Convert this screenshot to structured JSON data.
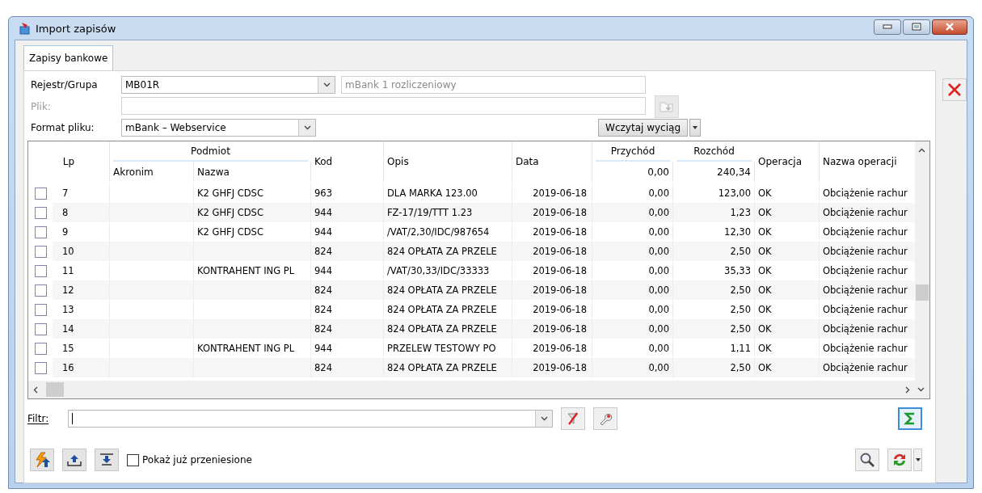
{
  "window": {
    "title": "Import zapisów"
  },
  "tabs": [
    {
      "label": "Zapisy bankowe",
      "selected": true
    }
  ],
  "form": {
    "rejestr_label": "Rejestr/Grupa",
    "rejestr_value": "MB01R",
    "rejestr_name": "mBank 1 rozliczeniowy",
    "plik_label": "Plik:",
    "plik_disabled": true,
    "format_label": "Format pliku:",
    "format_value": "mBank – Webservice",
    "load_button": "Wczytaj wyciąg"
  },
  "table": {
    "header": {
      "lp": "Lp",
      "podmiot": "Podmiot",
      "akronim": "Akronim",
      "nazwa": "Nazwa",
      "kod": "Kod",
      "opis": "Opis",
      "data": "Data",
      "przychod": "Przychód",
      "przychod_total": "0,00",
      "rozchod": "Rozchód",
      "rozchod_total": "240,34",
      "operacja": "Operacja",
      "nazwa_operacji": "Nazwa operacji"
    },
    "rows": [
      {
        "checked": false,
        "lp": "7",
        "nazwa": "K2 GHFJ CDSC",
        "kod": "963",
        "opis": "DLA MARKA 123.00",
        "data": "2019-06-18",
        "przychod": "0,00",
        "rozchod": "123,00",
        "operacja": "OK",
        "nazwa_operacji": "Obciążenie rachur"
      },
      {
        "checked": false,
        "lp": "8",
        "nazwa": "K2 GHFJ CDSC",
        "kod": "944",
        "opis": "FZ-17/19/TTT 1.23",
        "data": "2019-06-18",
        "przychod": "0,00",
        "rozchod": "1,23",
        "operacja": "OK",
        "nazwa_operacji": "Obciążenie rachur"
      },
      {
        "checked": false,
        "lp": "9",
        "nazwa": "K2 GHFJ CDSC",
        "kod": "944",
        "opis": "/VAT/2,30/IDC/987654",
        "data": "2019-06-18",
        "przychod": "0,00",
        "rozchod": "12,30",
        "operacja": "OK",
        "nazwa_operacji": "Obciążenie rachur"
      },
      {
        "checked": false,
        "lp": "10",
        "kod": "824",
        "opis": "824 OPŁATA ZA PRZELE",
        "data": "2019-06-18",
        "przychod": "0,00",
        "rozchod": "2,50",
        "operacja": "OK",
        "nazwa_operacji": "Obciążenie rachur"
      },
      {
        "checked": false,
        "lp": "11",
        "nazwa": "KONTRAHENT ING PL",
        "kod": "944",
        "opis": "/VAT/30,33/IDC/33333",
        "data": "2019-06-18",
        "przychod": "0,00",
        "rozchod": "35,33",
        "operacja": "OK",
        "nazwa_operacji": "Obciążenie rachur"
      },
      {
        "checked": false,
        "lp": "12",
        "kod": "824",
        "opis": "824 OPŁATA ZA PRZELE",
        "data": "2019-06-18",
        "przychod": "0,00",
        "rozchod": "2,50",
        "operacja": "OK",
        "nazwa_operacji": "Obciążenie rachur"
      },
      {
        "checked": false,
        "lp": "13",
        "kod": "824",
        "opis": "824 OPŁATA ZA PRZELE",
        "data": "2019-06-18",
        "przychod": "0,00",
        "rozchod": "2,50",
        "operacja": "OK",
        "nazwa_operacji": "Obciążenie rachur"
      },
      {
        "checked": false,
        "lp": "14",
        "kod": "824",
        "opis": "824 OPŁATA ZA PRZELE",
        "data": "2019-06-18",
        "przychod": "0,00",
        "rozchod": "2,50",
        "operacja": "OK",
        "nazwa_operacji": "Obciążenie rachur"
      },
      {
        "checked": false,
        "lp": "15",
        "nazwa": "KONTRAHENT ING PL",
        "kod": "944",
        "opis": "PRZELEW TESTOWY PO",
        "data": "2019-06-18",
        "przychod": "0,00",
        "rozchod": "1,11",
        "operacja": "OK",
        "nazwa_operacji": "Obciążenie rachur"
      },
      {
        "checked": false,
        "lp": "16",
        "kod": "824",
        "opis": "824 OPŁATA ZA PRZELE",
        "data": "2019-06-18",
        "przychod": "0,00",
        "rozchod": "2,50",
        "operacja": "OK",
        "nazwa_operacji": "Obciążenie rachur"
      }
    ]
  },
  "filter": {
    "label": "Filtr:"
  },
  "show_transferred": {
    "label": "Pokaż już przeniesione",
    "checked": false
  }
}
